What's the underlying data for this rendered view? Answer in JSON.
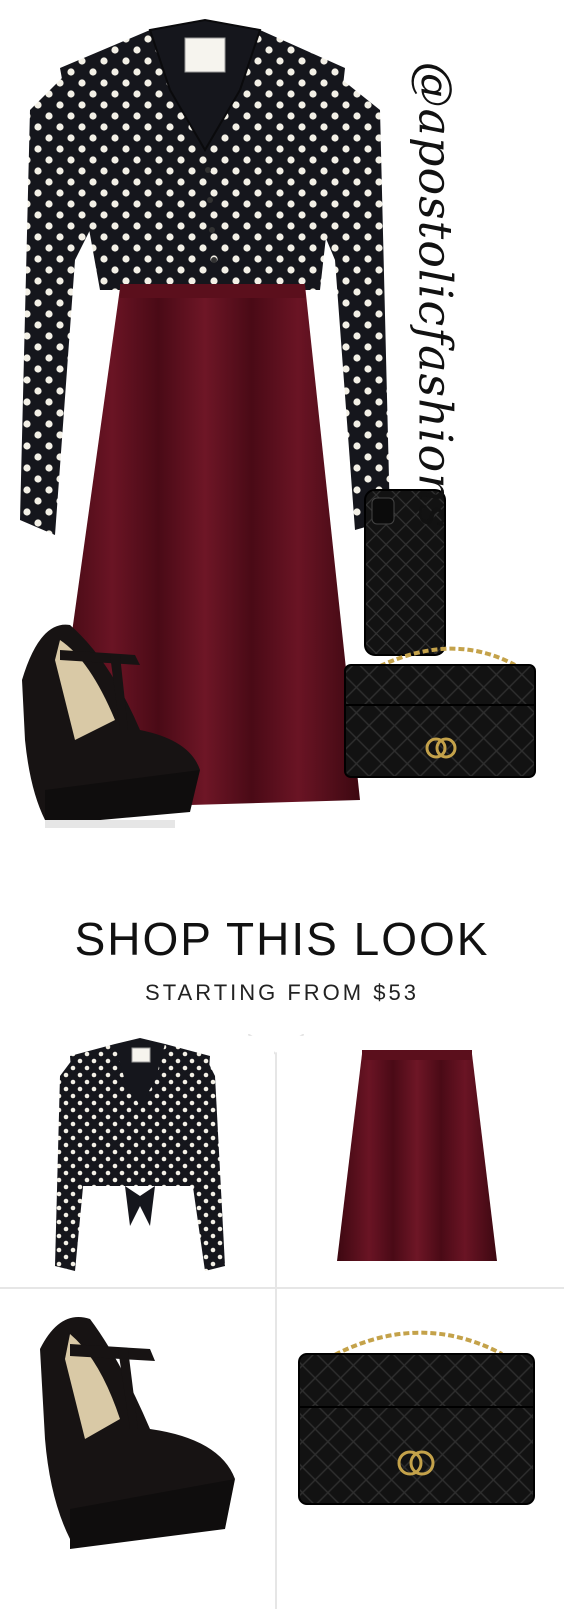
{
  "social": {
    "handle": "@apostolicfashions"
  },
  "shop": {
    "title": "SHOP THIS LOOK",
    "starting_from": "STARTING FROM $53"
  },
  "colors": {
    "skirt": "#5e0f1c",
    "blouse": "#15161c",
    "dots": "#f3f0e6",
    "suede": "#171313",
    "chain": "#c4a24a"
  },
  "products": [
    {
      "name": "polka-dot-blouse"
    },
    {
      "name": "burgundy-pleated-skirt"
    },
    {
      "name": "black-t-strap-wedge"
    },
    {
      "name": "quilted-chain-bag"
    }
  ]
}
